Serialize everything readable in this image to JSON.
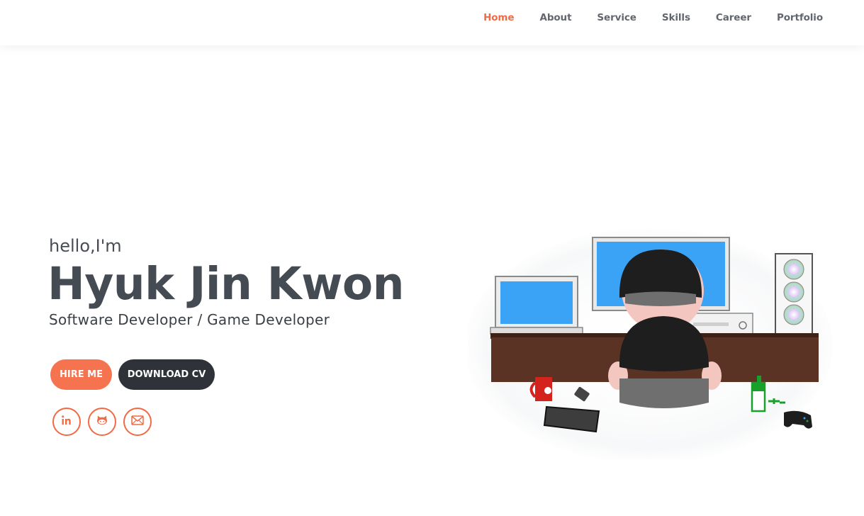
{
  "nav": {
    "items": [
      {
        "label": "Home",
        "active": true
      },
      {
        "label": "About",
        "active": false
      },
      {
        "label": "Service",
        "active": false
      },
      {
        "label": "Skills",
        "active": false
      },
      {
        "label": "Career",
        "active": false
      },
      {
        "label": "Portfolio",
        "active": false
      }
    ]
  },
  "hero": {
    "greeting": "hello,I'm",
    "name": "Hyuk Jin Kwon",
    "role": "Software Developer / Game Developer",
    "buttons": {
      "hire": "HIRE ME",
      "cv": "DOWNLOAD CV"
    },
    "socials": [
      "linkedin-icon",
      "github-icon",
      "mail-icon"
    ]
  },
  "colors": {
    "accent": "#f16a43",
    "button_orange": "#f5744f",
    "button_dark": "#2f3238",
    "text": "#454b53"
  }
}
